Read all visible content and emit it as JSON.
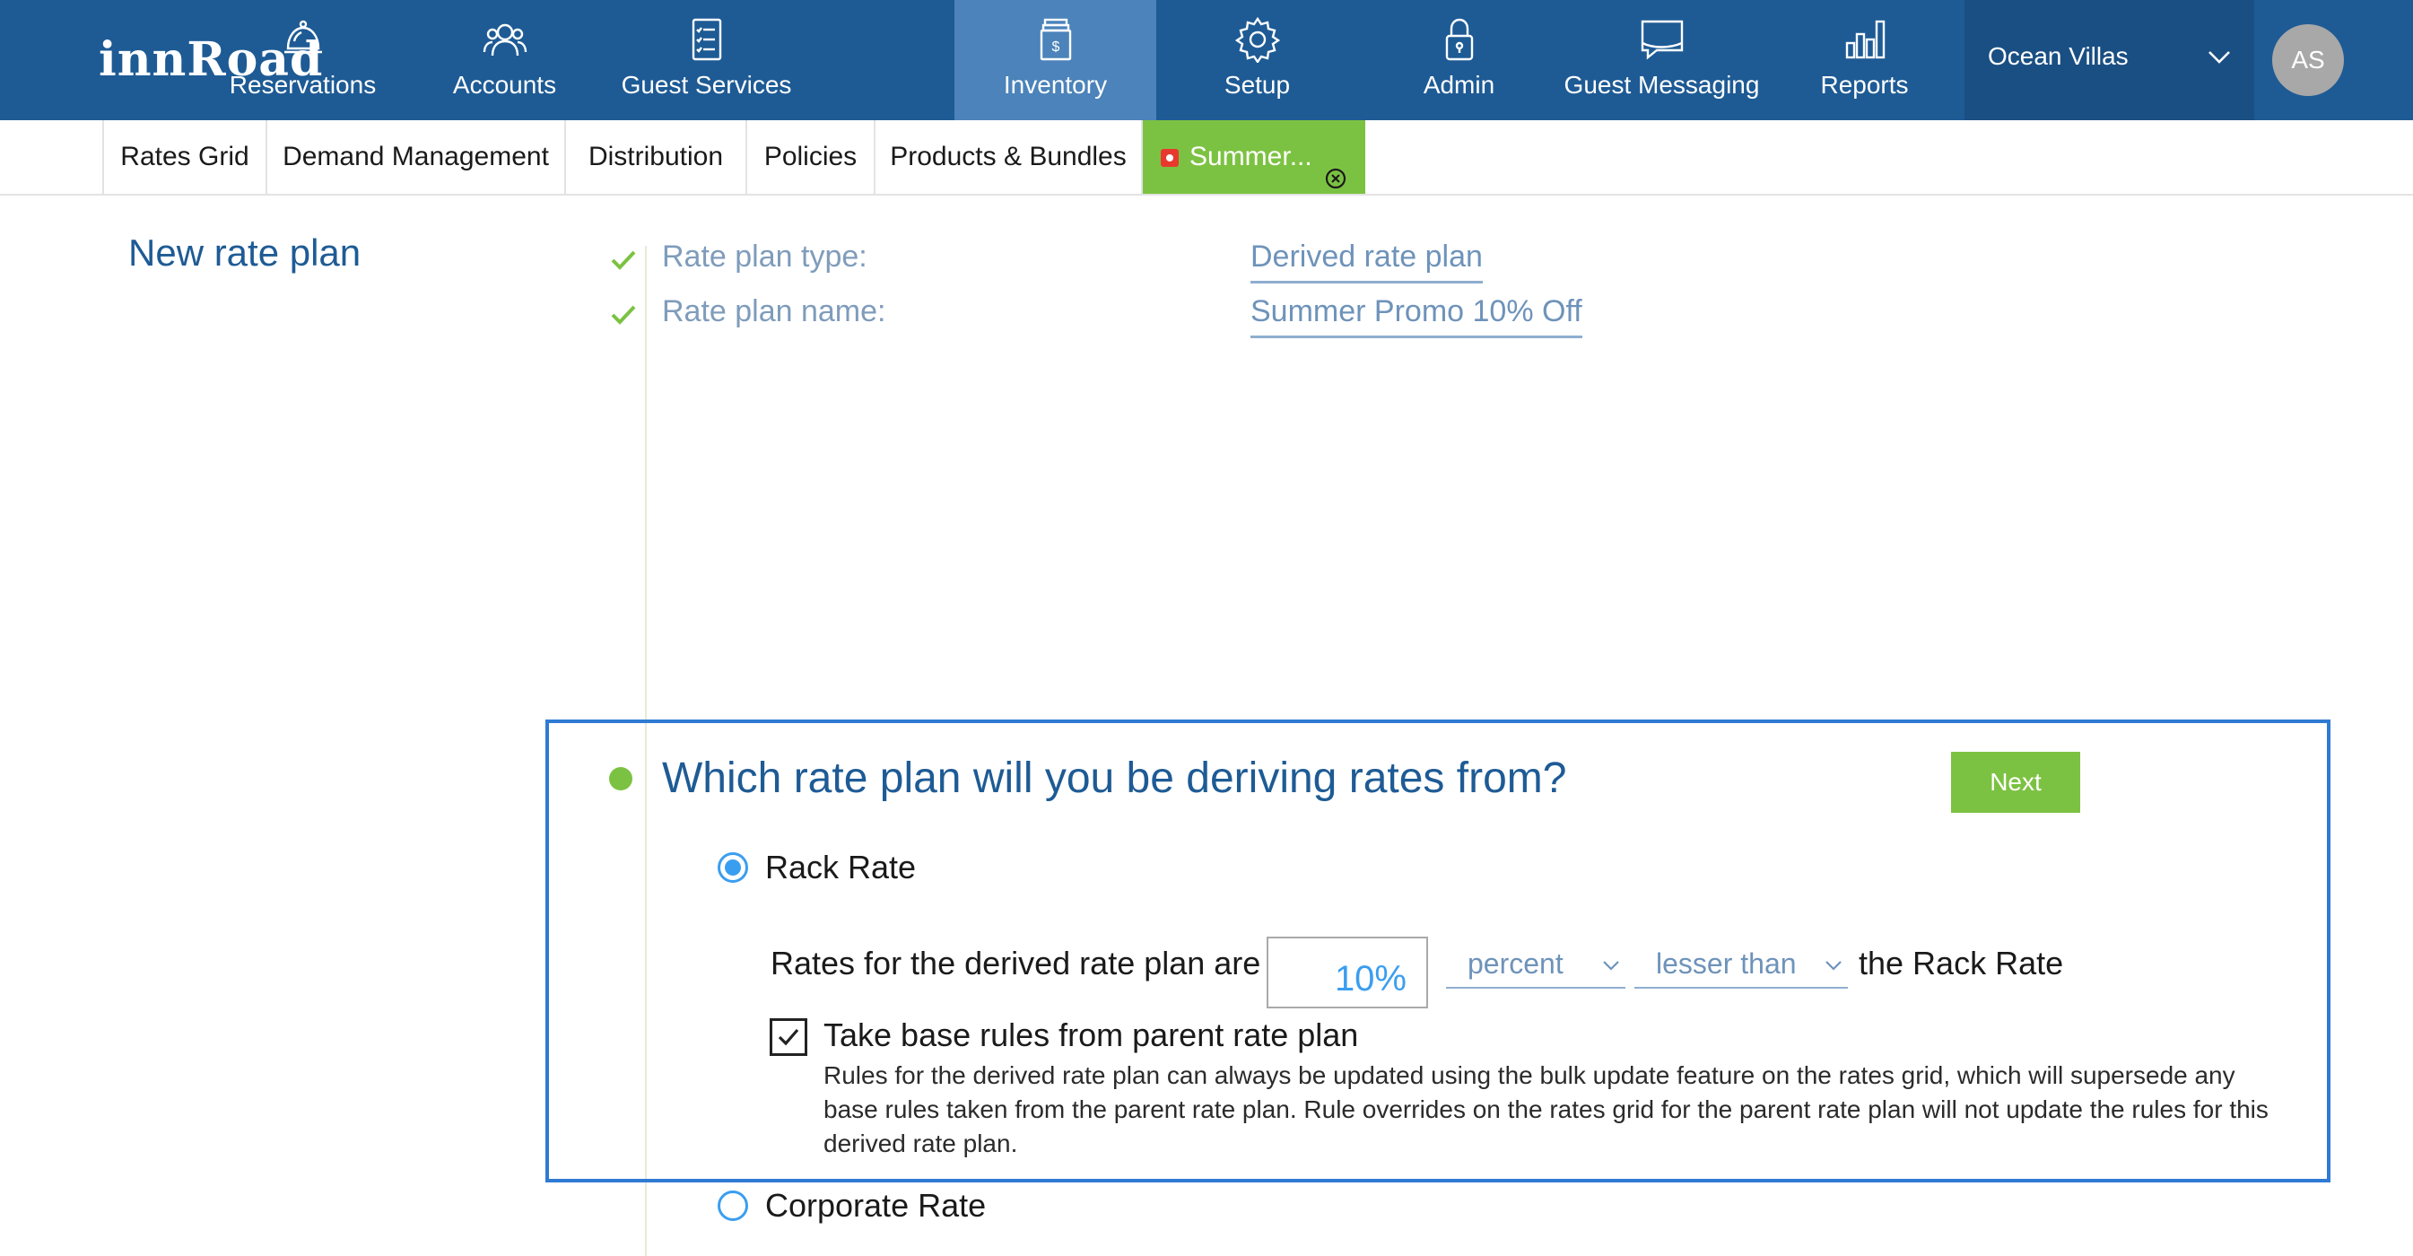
{
  "app": {
    "logo": "innRoad"
  },
  "topnav": {
    "items": [
      {
        "label": "Reservations",
        "icon": "bell-icon"
      },
      {
        "label": "Accounts",
        "icon": "users-icon"
      },
      {
        "label": "Guest Services",
        "icon": "checklist-icon"
      },
      {
        "label": "Inventory",
        "icon": "inventory-icon",
        "active": true
      },
      {
        "label": "Setup",
        "icon": "gear-icon"
      },
      {
        "label": "Admin",
        "icon": "lock-icon"
      },
      {
        "label": "Guest Messaging",
        "icon": "message-icon"
      },
      {
        "label": "Reports",
        "icon": "bar-chart-icon"
      }
    ],
    "property": "Ocean Villas",
    "user_initials": "AS"
  },
  "subnav": {
    "items": [
      "Rates Grid",
      "Demand Management",
      "Distribution",
      "Policies",
      "Products & Bundles"
    ],
    "active_tab": "Summer..."
  },
  "page": {
    "title": "New rate plan",
    "steps": [
      {
        "label": "Rate plan type:",
        "value": "Derived rate plan"
      },
      {
        "label": "Rate plan name:",
        "value": "Summer Promo 10% Off"
      }
    ],
    "question": "Which rate plan will you be deriving rates from?",
    "next_label": "Next",
    "options": [
      {
        "label": "Rack Rate",
        "selected": true
      },
      {
        "label": "Corporate Rate",
        "selected": false
      }
    ],
    "derived": {
      "prefix": "Rates for the derived rate plan are",
      "amount": "10%",
      "unit": "percent",
      "comparison": "lesser than",
      "suffix": "the Rack Rate"
    },
    "base_rules": {
      "label": "Take base rules from parent rate plan",
      "checked": true,
      "help": "Rules for the derived rate plan can always be updated using the bulk update feature on the rates grid, which will supersede any base rules taken from the parent rate plan. Rule overrides on the rates grid for the parent rate plan will not update the rules for this derived rate plan."
    }
  },
  "colors": {
    "nav_bg": "#1e5b95",
    "nav_active": "#4b83ba",
    "accent_green": "#7cc242",
    "panel_border": "#2f7ad3",
    "link_blue": "#6e93ba"
  }
}
